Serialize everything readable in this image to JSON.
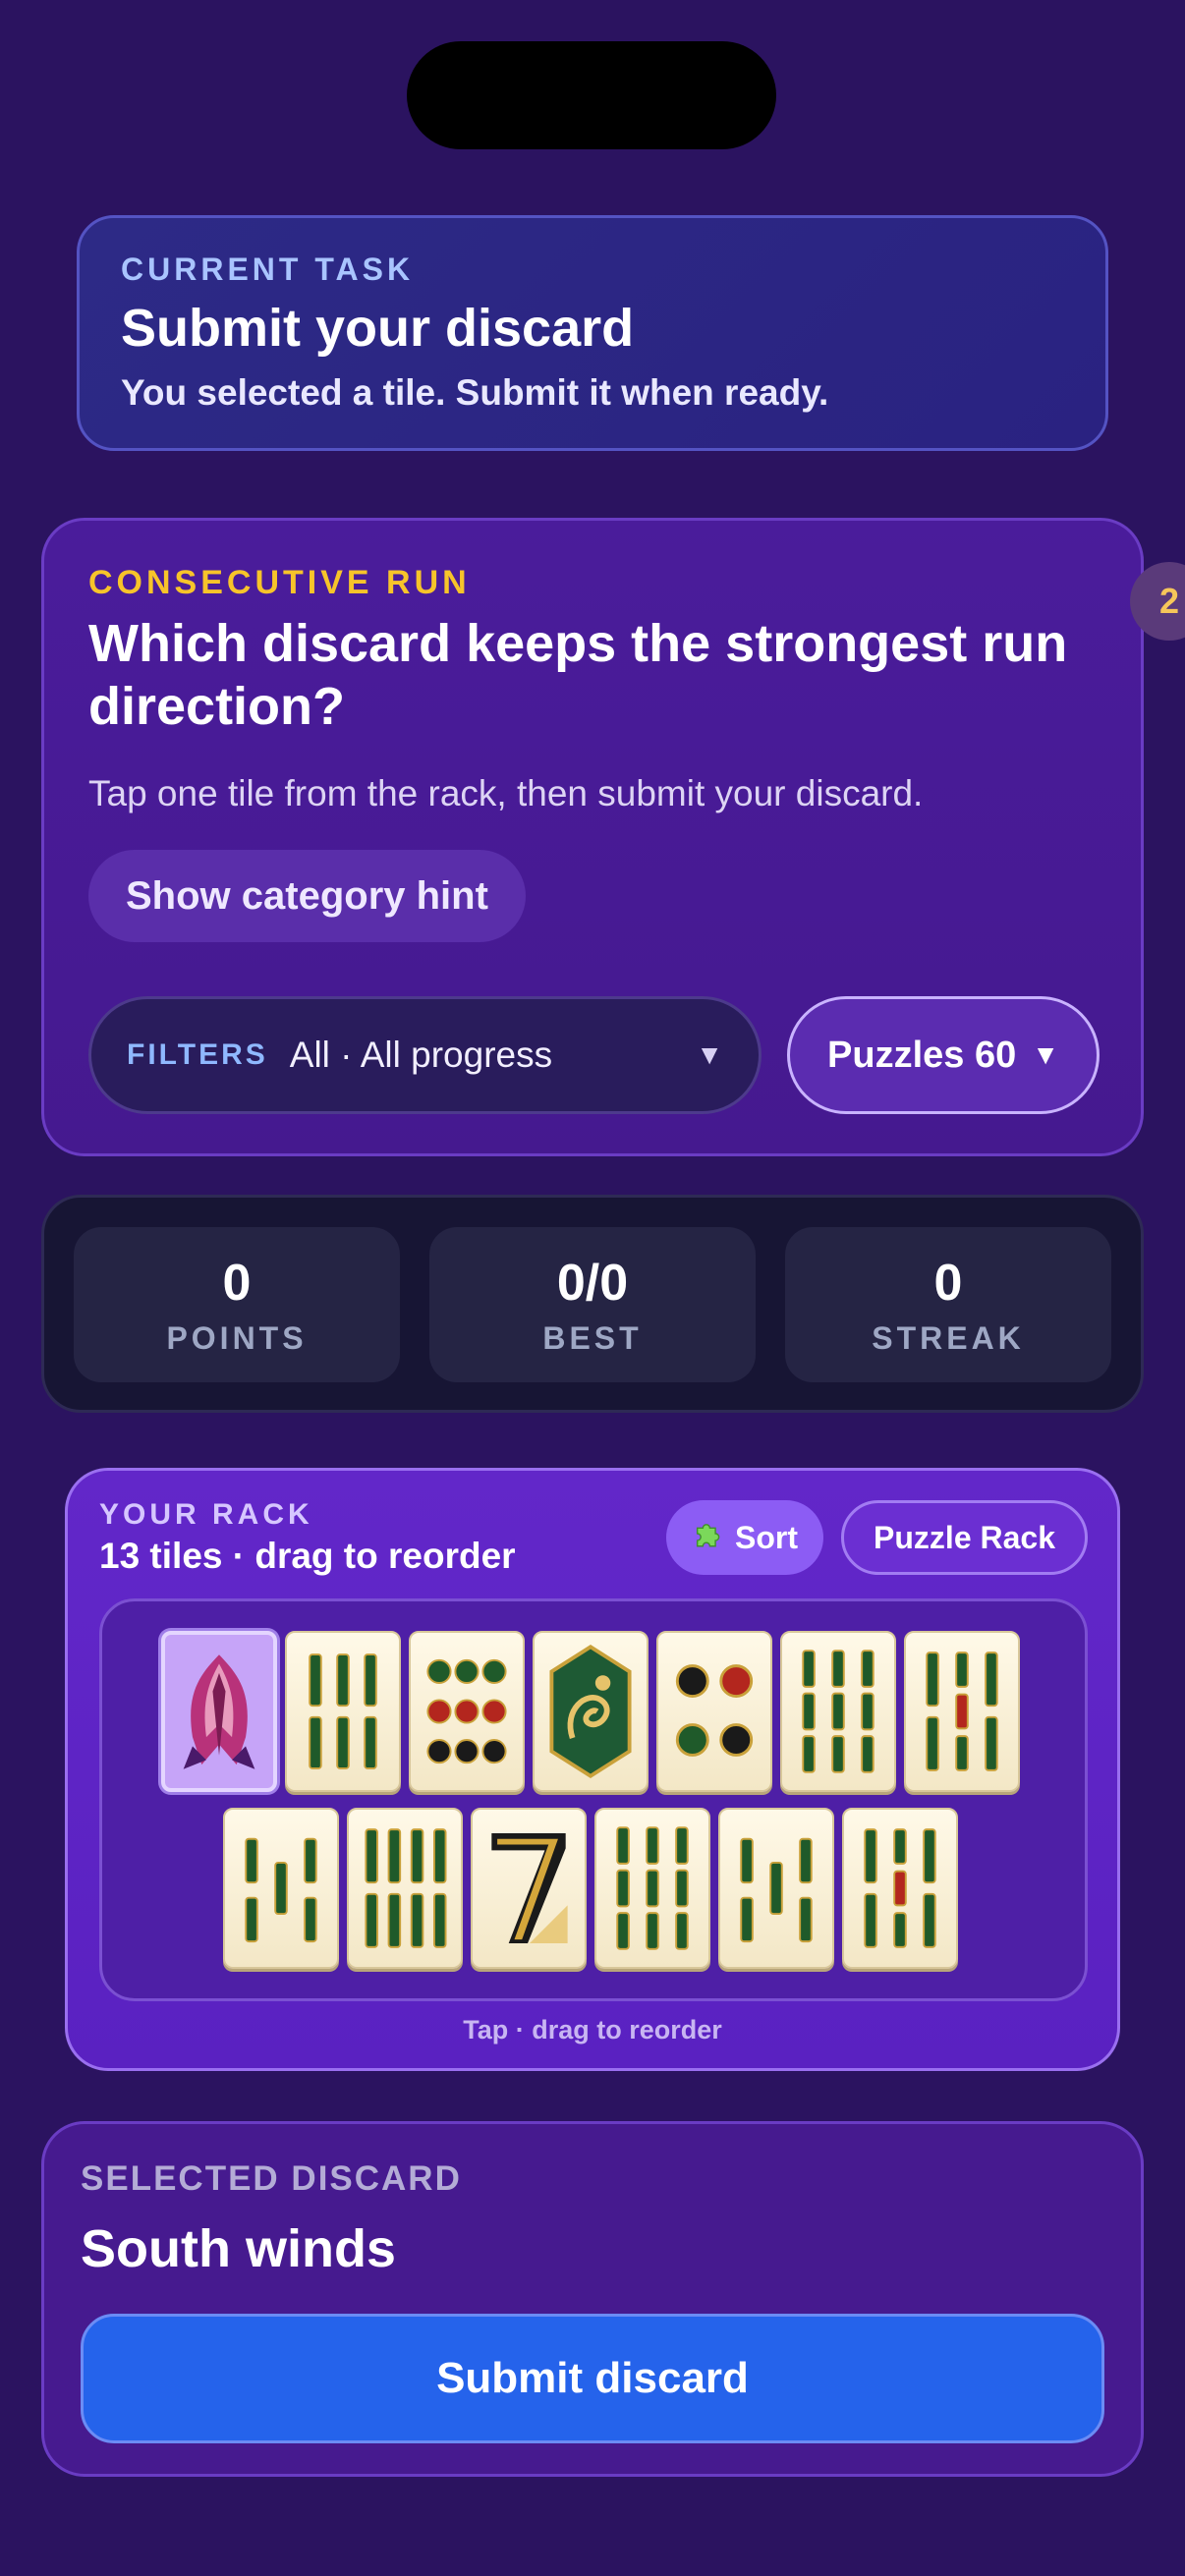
{
  "task": {
    "kicker": "CURRENT TASK",
    "title": "Submit your discard",
    "subtitle": "You selected a tile. Submit it when ready."
  },
  "puzzle": {
    "category": "CONSECUTIVE RUN",
    "question": "Which discard keeps the strongest run direction?",
    "instruction": "Tap one tile from the rack, then submit your discard.",
    "hint_label": "Show category hint",
    "filters_label": "FILTERS",
    "filters_value": "All · All progress",
    "puzzles_label": "Puzzles 60",
    "side_badge": "2"
  },
  "stats": [
    {
      "value": "0",
      "label": "POINTS"
    },
    {
      "value": "0/0",
      "label": "BEST"
    },
    {
      "value": "0",
      "label": "STREAK"
    }
  ],
  "rack": {
    "kicker": "YOUR RACK",
    "title": "13 tiles · drag to reorder",
    "sort_label": "Sort",
    "sort_icon": "puzzle-piece-icon",
    "puzzle_rack_label": "Puzzle Rack",
    "footer": "Tap · drag to reorder",
    "tiles_row1": [
      "south-wind (selected)",
      "bamboo-6",
      "dots-9",
      "dragon",
      "dots-4",
      "bamboo-9",
      "bamboo-7"
    ],
    "tiles_row2": [
      "bamboo-5",
      "bamboo-8",
      "seven",
      "bamboo-9",
      "bamboo-5",
      "bamboo-7"
    ]
  },
  "discard": {
    "kicker": "SELECTED DISCARD",
    "tile_name": "South winds",
    "submit_label": "Submit discard"
  },
  "colors": {
    "background": "#2b1360",
    "accent_gold": "#f7c42a",
    "submit_blue": "#2563eb",
    "rack_purple": "#6227c9"
  }
}
